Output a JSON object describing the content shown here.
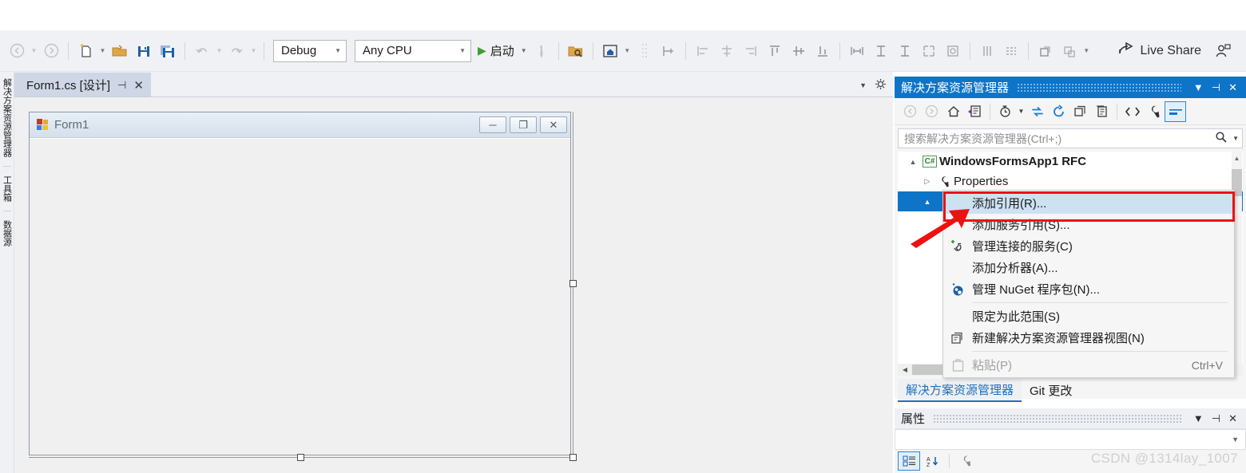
{
  "toolbar": {
    "nav_back": "nav-back",
    "nav_forward": "nav-forward",
    "new_item": "new-item",
    "open_file": "open-file",
    "save": "save",
    "save_all": "save-all",
    "undo": "undo",
    "redo": "redo",
    "configuration": "Debug",
    "platform": "Any CPU",
    "run_label": "启动",
    "live_share": "Live Share"
  },
  "rail": {
    "items": [
      {
        "label": "解决方案资源管理器"
      },
      {
        "label": "工具箱"
      },
      {
        "label": "数据源"
      }
    ]
  },
  "document_tab": {
    "title": "Form1.cs [设计]",
    "pin_glyph": "⊣",
    "close_glyph": "✕"
  },
  "designer": {
    "form_title": "Form1",
    "minimize_glyph": "─",
    "maximize_glyph": "❐",
    "close_glyph": "✕"
  },
  "solution_explorer": {
    "title": "解决方案资源管理器",
    "dropdown_glyph": "▼",
    "pin_glyph": "⊣",
    "close_glyph": "✕",
    "search_placeholder": "搜索解决方案资源管理器(Ctrl+;)",
    "toolbar_icons": [
      "back-icon",
      "forward-icon",
      "home-icon",
      "sync-with-active-document-icon",
      "pending-changes-filter-icon",
      "refresh-icon",
      "collapse-all-icon",
      "show-all-files-icon",
      "copy-icon",
      "view-code-icon",
      "properties-icon",
      "preview-selected-items-icon"
    ],
    "tree": [
      {
        "label": "WindowsFormsApp1 RFC",
        "badge": "C#",
        "expander": "▲",
        "level": 0,
        "bold": true
      },
      {
        "label": "Properties",
        "icon": "wrench-icon",
        "expander": "▷",
        "level": 1,
        "bold": false
      },
      {
        "label": "",
        "expander": "▲",
        "level": 1,
        "bold": false,
        "selected": true
      }
    ]
  },
  "context_menu": {
    "items": [
      {
        "label": "添加引用(R)...",
        "icon": "",
        "shortcut": "",
        "highlighted": true,
        "disabled": false
      },
      {
        "label": "添加服务引用(S)...",
        "icon": "",
        "shortcut": "",
        "highlighted": false,
        "disabled": false
      },
      {
        "label": "管理连接的服务(C)",
        "icon": "connected-services-icon",
        "shortcut": "",
        "highlighted": false,
        "disabled": false
      },
      {
        "label": "添加分析器(A)...",
        "icon": "",
        "shortcut": "",
        "highlighted": false,
        "disabled": false
      },
      {
        "label": "管理 NuGet 程序包(N)...",
        "icon": "nuget-icon",
        "shortcut": "",
        "highlighted": false,
        "disabled": false
      },
      {
        "label": "限定为此范围(S)",
        "icon": "",
        "shortcut": "",
        "highlighted": false,
        "disabled": false,
        "divider_before": true
      },
      {
        "label": "新建解决方案资源管理器视图(N)",
        "icon": "new-view-icon",
        "shortcut": "",
        "highlighted": false,
        "disabled": false
      },
      {
        "label": "粘贴(P)",
        "icon": "paste-icon",
        "shortcut": "Ctrl+V",
        "highlighted": false,
        "disabled": true,
        "divider_before": true
      }
    ]
  },
  "bottom_tabs": [
    {
      "label": "解决方案资源管理器",
      "active": true
    },
    {
      "label": "Git 更改",
      "active": false
    }
  ],
  "properties": {
    "title": "属性",
    "dropdown_glyph": "▼",
    "pin_glyph": "⊣",
    "close_glyph": "✕",
    "combo_value": "",
    "combo_arrow": "▼",
    "toolbar_icons": [
      "categorized-icon",
      "alphabetical-icon",
      "properties-icon"
    ]
  },
  "watermark": "CSDN @1314lay_1007",
  "colors": {
    "accent": "#0d74c8",
    "highlight_red": "#ee1111",
    "menu_highlight": "#cde1f3",
    "toolbar_bg": "#eff1f5",
    "run_green": "#3f9c35"
  }
}
